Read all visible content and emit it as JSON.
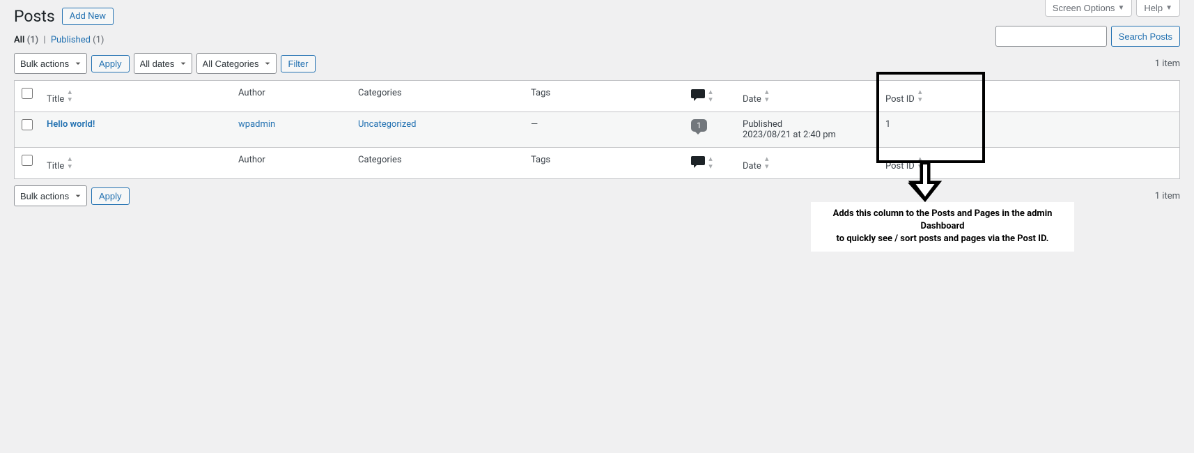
{
  "topbar": {
    "screen_options": "Screen Options",
    "help": "Help"
  },
  "header": {
    "title": "Posts",
    "add_new": "Add New"
  },
  "filters": {
    "all_label": "All",
    "all_count": "(1)",
    "published_label": "Published",
    "published_count": "(1)"
  },
  "search": {
    "button": "Search Posts"
  },
  "tablenav": {
    "bulk_actions": "Bulk actions",
    "apply": "Apply",
    "all_dates": "All dates",
    "all_categories": "All Categories",
    "filter": "Filter",
    "items_count": "1 item"
  },
  "columns": {
    "title": "Title",
    "author": "Author",
    "categories": "Categories",
    "tags": "Tags",
    "date": "Date",
    "post_id": "Post ID"
  },
  "rows": [
    {
      "title": "Hello world!",
      "author": "wpadmin",
      "categories": "Uncategorized",
      "tags": "—",
      "comments": "1",
      "date_status": "Published",
      "date_value": "2023/08/21 at 2:40 pm",
      "post_id": "1"
    }
  ],
  "callout": {
    "line1": "Adds this  column to the Posts and Pages in the admin Dashboard",
    "line2": "to quickly see / sort posts and pages  via the Post ID."
  }
}
